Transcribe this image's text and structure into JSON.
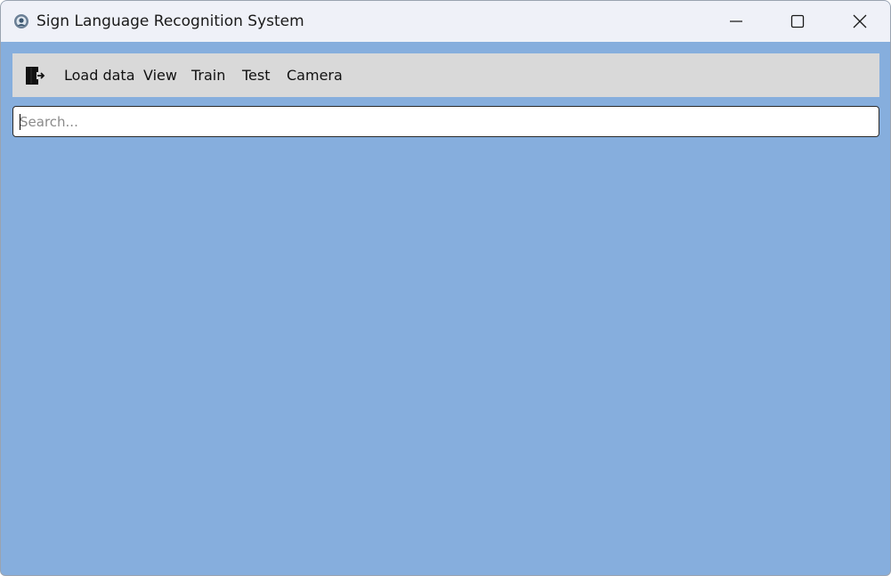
{
  "window": {
    "title": "Sign Language Recognition System",
    "app_icon": "app-logo-icon",
    "controls": {
      "minimize_icon": "minimize-icon",
      "maximize_icon": "maximize-icon",
      "close_icon": "close-icon"
    },
    "background_color": "#86aedd"
  },
  "menubar": {
    "exit_icon": "exit-door-icon",
    "items": [
      {
        "label": "Load data"
      },
      {
        "label": "View"
      },
      {
        "label": "Train"
      },
      {
        "label": "Test"
      },
      {
        "label": "Camera"
      }
    ],
    "background_color": "#d9d9d9"
  },
  "search": {
    "placeholder": "Search...",
    "value": ""
  }
}
